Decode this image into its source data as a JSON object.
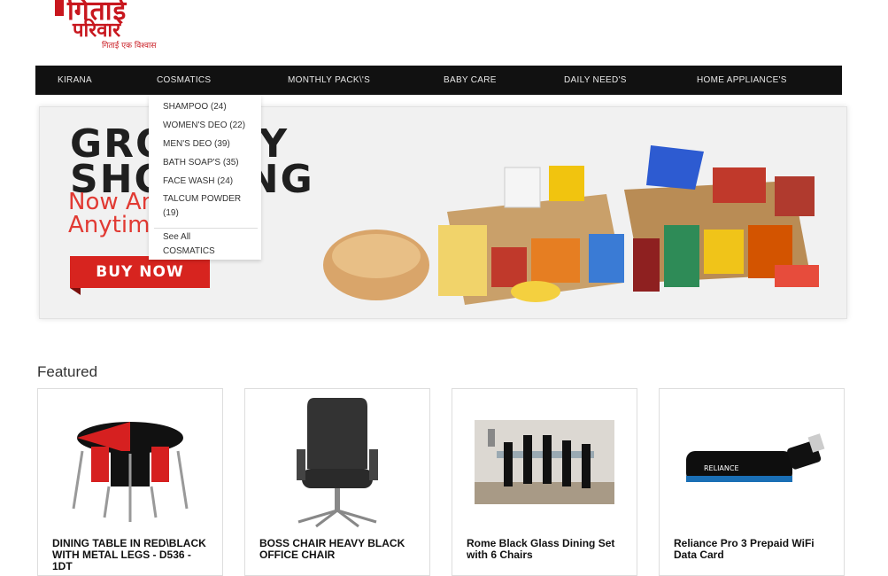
{
  "logo": {
    "line1": "गिताई",
    "line2": "परिवार",
    "tagline": "गिताई एक विश्वास"
  },
  "nav": {
    "items": [
      "KIRANA",
      "COSMATICS",
      "MONTHLY PACK\\'S",
      "BABY CARE",
      "DAILY NEED'S",
      "HOME APPLIANCE'S"
    ]
  },
  "dropdown": {
    "items": [
      "SHAMPOO (24)",
      "WOMEN'S DEO (22)",
      "MEN'S DEO (39)",
      "BATH SOAP'S (35)",
      "FACE WASH (24)",
      "TALCUM POWDER (19)"
    ],
    "see_all": "See All COSMATICS"
  },
  "banner": {
    "line1": "GROCERY",
    "line2": "SHOPPING",
    "line3": "Now Anywhere..",
    "line4": "Anytime",
    "button": "BUY NOW"
  },
  "featured": {
    "title": "Featured",
    "products": [
      "DINING TABLE IN RED\\BLACK WITH METAL LEGS - D536 - 1DT",
      "BOSS CHAIR HEAVY BLACK OFFICE CHAIR",
      "Rome Black Glass Dining Set with 6 Chairs",
      "Reliance Pro 3 Prepaid WiFi Data Card"
    ]
  },
  "colors": {
    "brand_red": "#c8171e",
    "nav_bg": "#111111",
    "buy_red": "#d7241f"
  }
}
